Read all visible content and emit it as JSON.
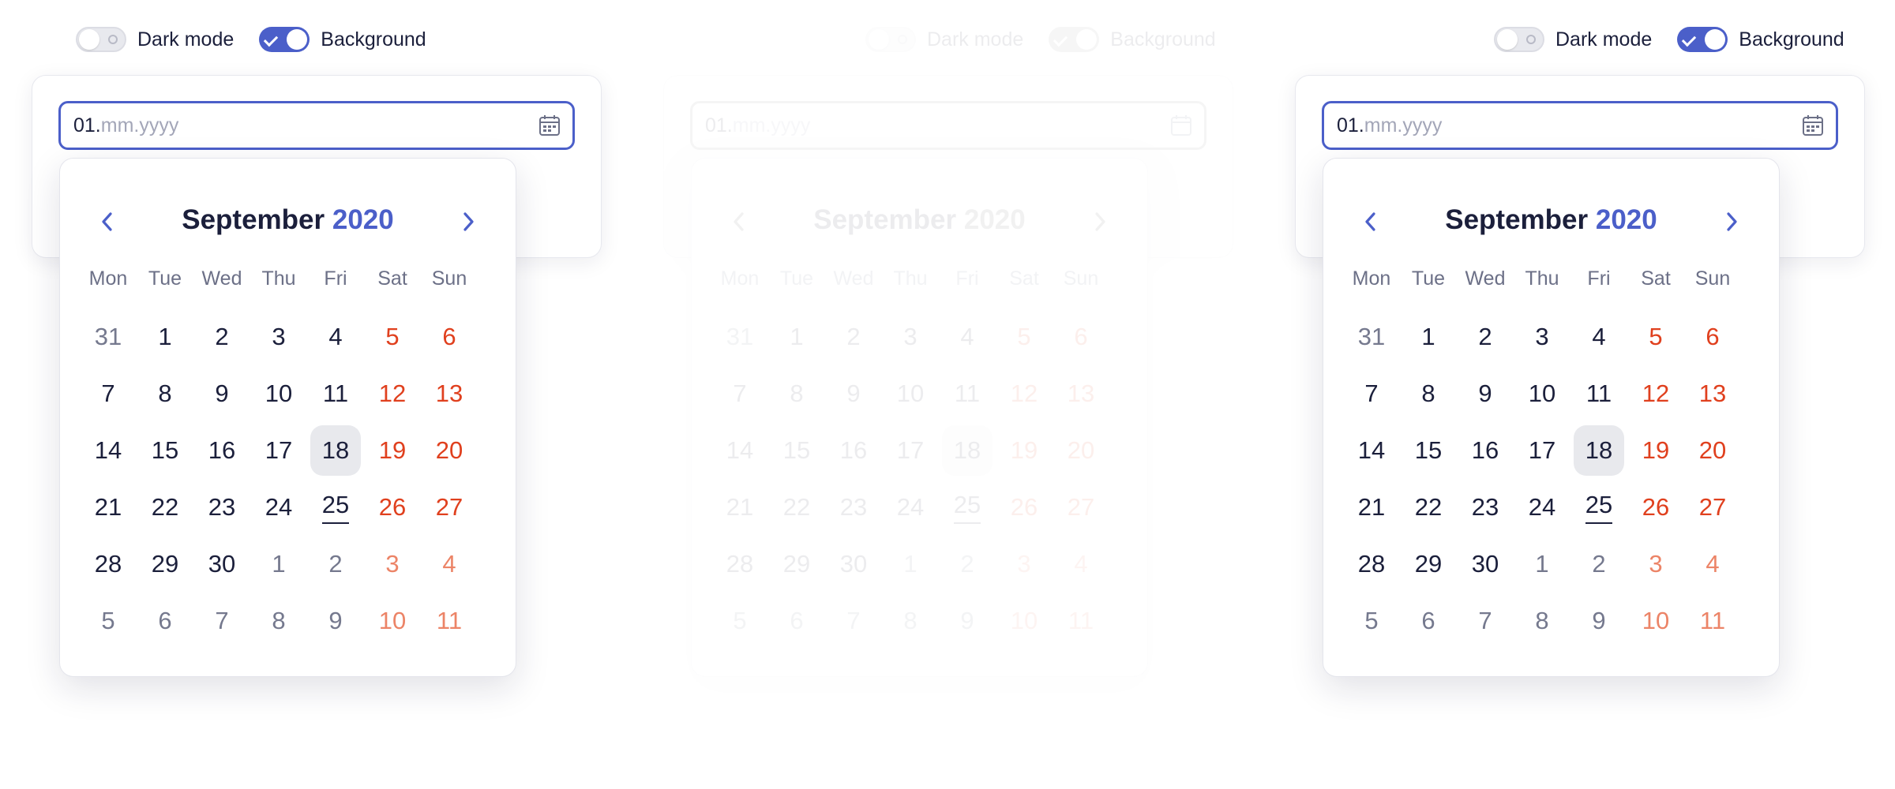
{
  "toggles": {
    "dark_mode_label": "Dark mode",
    "background_label": "Background",
    "dark_mode_on": false,
    "background_on": true
  },
  "input": {
    "value": "01.",
    "placeholder": "mm.yyyy"
  },
  "calendar": {
    "month": "September",
    "year": "2020",
    "weekdays": [
      "Mon",
      "Tue",
      "Wed",
      "Thu",
      "Fri",
      "Sat",
      "Sun"
    ],
    "weeks": [
      [
        "31",
        "1",
        "2",
        "3",
        "4",
        "5",
        "6"
      ],
      [
        "7",
        "8",
        "9",
        "10",
        "11",
        "12",
        "13"
      ],
      [
        "14",
        "15",
        "16",
        "17",
        "18",
        "19",
        "20"
      ],
      [
        "21",
        "22",
        "23",
        "24",
        "25",
        "26",
        "27"
      ],
      [
        "28",
        "29",
        "30",
        "1",
        "2",
        "3",
        "4"
      ],
      [
        "5",
        "6",
        "7",
        "8",
        "9",
        "10",
        "11"
      ]
    ],
    "outside_month_cells": [
      [
        0,
        0
      ],
      [
        4,
        3
      ],
      [
        4,
        4
      ],
      [
        4,
        5
      ],
      [
        4,
        6
      ],
      [
        5,
        0
      ],
      [
        5,
        1
      ],
      [
        5,
        2
      ],
      [
        5,
        3
      ],
      [
        5,
        4
      ],
      [
        5,
        5
      ],
      [
        5,
        6
      ]
    ],
    "selected_cell": [
      2,
      4
    ],
    "underlined_cell": [
      3,
      4
    ]
  },
  "colors": {
    "accent": "#4b5fc9",
    "weekend": "#e0401e",
    "text": "#1b1f3b",
    "muted": "#75798e"
  },
  "icons": {
    "prev": "chevron-left-icon",
    "next": "chevron-right-icon",
    "calendar": "calendar-icon",
    "check": "check-icon"
  }
}
